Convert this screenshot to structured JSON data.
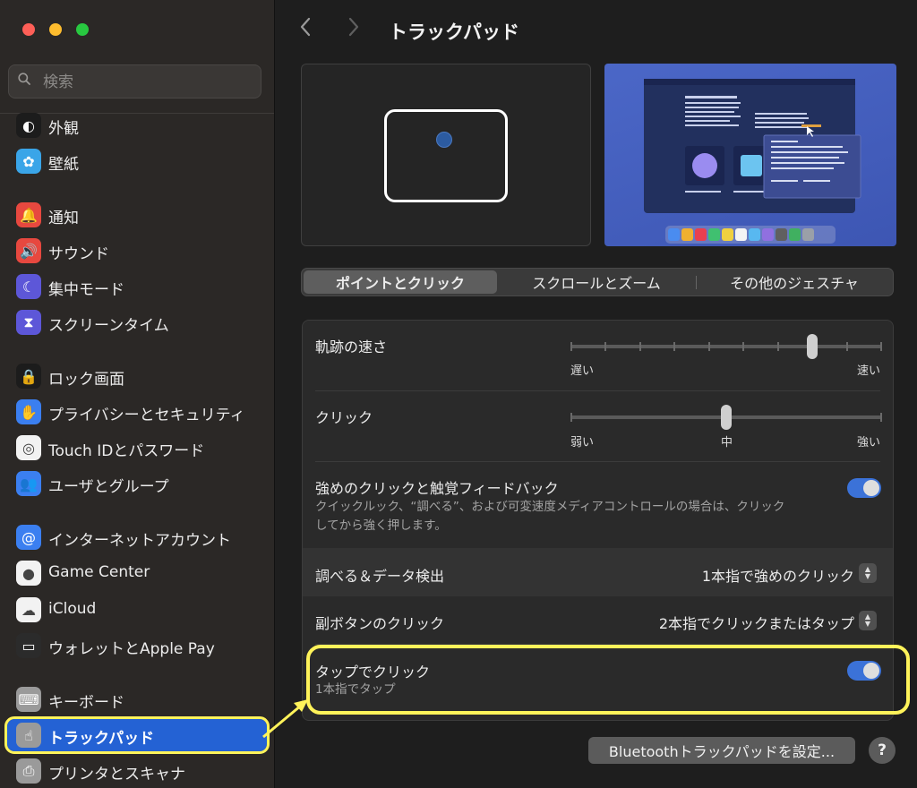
{
  "window": {
    "title": "トラックパッド"
  },
  "search": {
    "placeholder": "検索"
  },
  "sidebar": {
    "items": [
      {
        "label": "外観",
        "icon": "appearance-icon",
        "color": "#1c1c1c"
      },
      {
        "label": "壁紙",
        "icon": "wallpaper-icon",
        "color": "#3aa5e8"
      },
      {
        "label": "通知",
        "icon": "bell-icon",
        "color": "#e7483f"
      },
      {
        "label": "サウンド",
        "icon": "speaker-icon",
        "color": "#e7483f"
      },
      {
        "label": "集中モード",
        "icon": "moon-icon",
        "color": "#5d57d8"
      },
      {
        "label": "スクリーンタイム",
        "icon": "hourglass-icon",
        "color": "#5d57d8"
      },
      {
        "label": "ロック画面",
        "icon": "lock-icon",
        "color": "#1c1c1c"
      },
      {
        "label": "プライバシーとセキュリティ",
        "icon": "hand-icon",
        "color": "#3b7ff0"
      },
      {
        "label": "Touch IDとパスワード",
        "icon": "fingerprint-icon",
        "color": "#f2f2f2"
      },
      {
        "label": "ユーザとグループ",
        "icon": "users-icon",
        "color": "#3b7ff0"
      },
      {
        "label": "インターネットアカウント",
        "icon": "at-icon",
        "color": "#3b7ff0"
      },
      {
        "label": "Game Center",
        "icon": "game-center-icon",
        "color": "#f2f2f2"
      },
      {
        "label": "iCloud",
        "icon": "cloud-icon",
        "color": "#f2f2f2"
      },
      {
        "label": "ウォレットとApple Pay",
        "icon": "wallet-icon",
        "color": "#2b2b2b"
      },
      {
        "label": "キーボード",
        "icon": "keyboard-icon",
        "color": "#9a9a9a"
      },
      {
        "label": "トラックパッド",
        "icon": "trackpad-icon",
        "color": "#9a9a9a"
      },
      {
        "label": "プリンタとスキャナ",
        "icon": "printer-icon",
        "color": "#9a9a9a"
      }
    ],
    "selected": "トラックパッド"
  },
  "tabs": [
    {
      "label": "ポイントとクリック",
      "active": true
    },
    {
      "label": "スクロールとズーム",
      "active": false
    },
    {
      "label": "その他のジェスチャ",
      "active": false
    }
  ],
  "settings": {
    "tracking": {
      "label": "軌跡の速さ",
      "min_label": "遅い",
      "max_label": "速い",
      "ticks": 10,
      "value_index": 7
    },
    "click": {
      "label": "クリック",
      "min_label": "弱い",
      "mid_label": "中",
      "max_label": "強い",
      "ticks": 3,
      "value_index": 1
    },
    "force_click": {
      "label": "強めのクリックと触覚フィードバック",
      "description_line1": "クイックルック、“調べる”、および可変速度メディアコントロールの場合は、クリック",
      "description_line2": "してから強く押します。",
      "enabled": true
    },
    "lookup": {
      "label": "調べる＆データ検出",
      "value": "1本指で強めのクリック"
    },
    "secondary_click": {
      "label": "副ボタンのクリック",
      "value": "2本指でクリックまたはタップ"
    },
    "tap_to_click": {
      "label": "タップでクリック",
      "description": "1本指でタップ",
      "enabled": true
    }
  },
  "footer": {
    "bluetooth_button": "Bluetoothトラックパッドを設定...",
    "help": "?"
  },
  "colors": {
    "accent": "#2462d4",
    "highlight": "#fff35a",
    "toggle_on": "#3b72d8"
  }
}
